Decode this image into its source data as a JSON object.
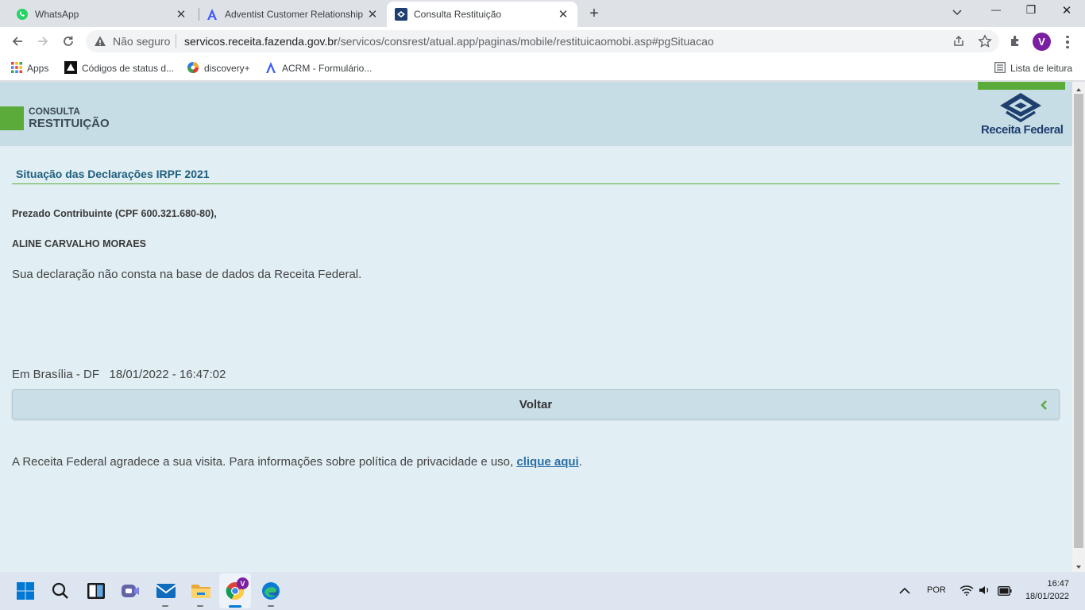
{
  "browser": {
    "tabs": [
      {
        "title": "WhatsApp",
        "close": "✕"
      },
      {
        "title": "Adventist Customer Relationship",
        "close": "✕"
      },
      {
        "title": "Consulta Restituição",
        "close": "✕"
      }
    ],
    "new_tab": "+",
    "window_controls": {
      "minimize": "—",
      "restore": "❐",
      "close": "✕"
    },
    "security_label": "Não seguro",
    "url_host": "servicos.receita.fazenda.gov.br",
    "url_path": "/servicos/consrest/atual.app/paginas/mobile/restituicaomobi.asp#pgSituacao",
    "profile_initial": "V",
    "bookmarks": [
      "Apps",
      "Códigos de status d...",
      "discovery+",
      "ACRM - Formulário..."
    ],
    "reading_list": "Lista de leitura"
  },
  "page": {
    "header_top": "CONSULTA",
    "header_main": "RESTITUIÇÃO",
    "logo_text": "Receita Federal",
    "section_title": "Situação das Declarações IRPF 2021",
    "greeting": "Prezado Contribuinte (CPF 600.321.680-80),",
    "name": "ALINE CARVALHO MORAES",
    "message": "Sua declaração não consta na base de dados da Receita Federal.",
    "place_date": "Em Brasília - DF   18/01/2022 - 16:47:02",
    "back_button": "Voltar",
    "footer_text": "A Receita Federal agradece a sua visita. Para informações sobre política de privacidade e uso, ",
    "footer_link": "clique aqui",
    "footer_end": "."
  },
  "taskbar": {
    "language": "POR",
    "time": "16:47",
    "date": "18/01/2022",
    "chrome_badge": "V"
  },
  "colors": {
    "header_bg": "#c7dde6",
    "page_bg": "#e1eef3",
    "accent_green": "#5aab3a",
    "title_blue": "#1f5f7e",
    "logo_navy": "#1f3f6e",
    "link_blue": "#2a6fa8"
  },
  "icons": [
    "whatsapp-icon",
    "acrm-icon",
    "receita-icon",
    "back-icon",
    "forward-icon",
    "reload-icon",
    "warning-icon",
    "share-icon",
    "star-icon",
    "extensions-icon",
    "menu-icon",
    "apps-icon",
    "reading-list-icon",
    "chevron-left-icon",
    "windows-start-icon",
    "search-icon",
    "task-view-icon",
    "teams-icon",
    "mail-icon",
    "explorer-icon",
    "chrome-icon",
    "edge-icon",
    "wifi-icon",
    "volume-icon",
    "battery-icon"
  ]
}
